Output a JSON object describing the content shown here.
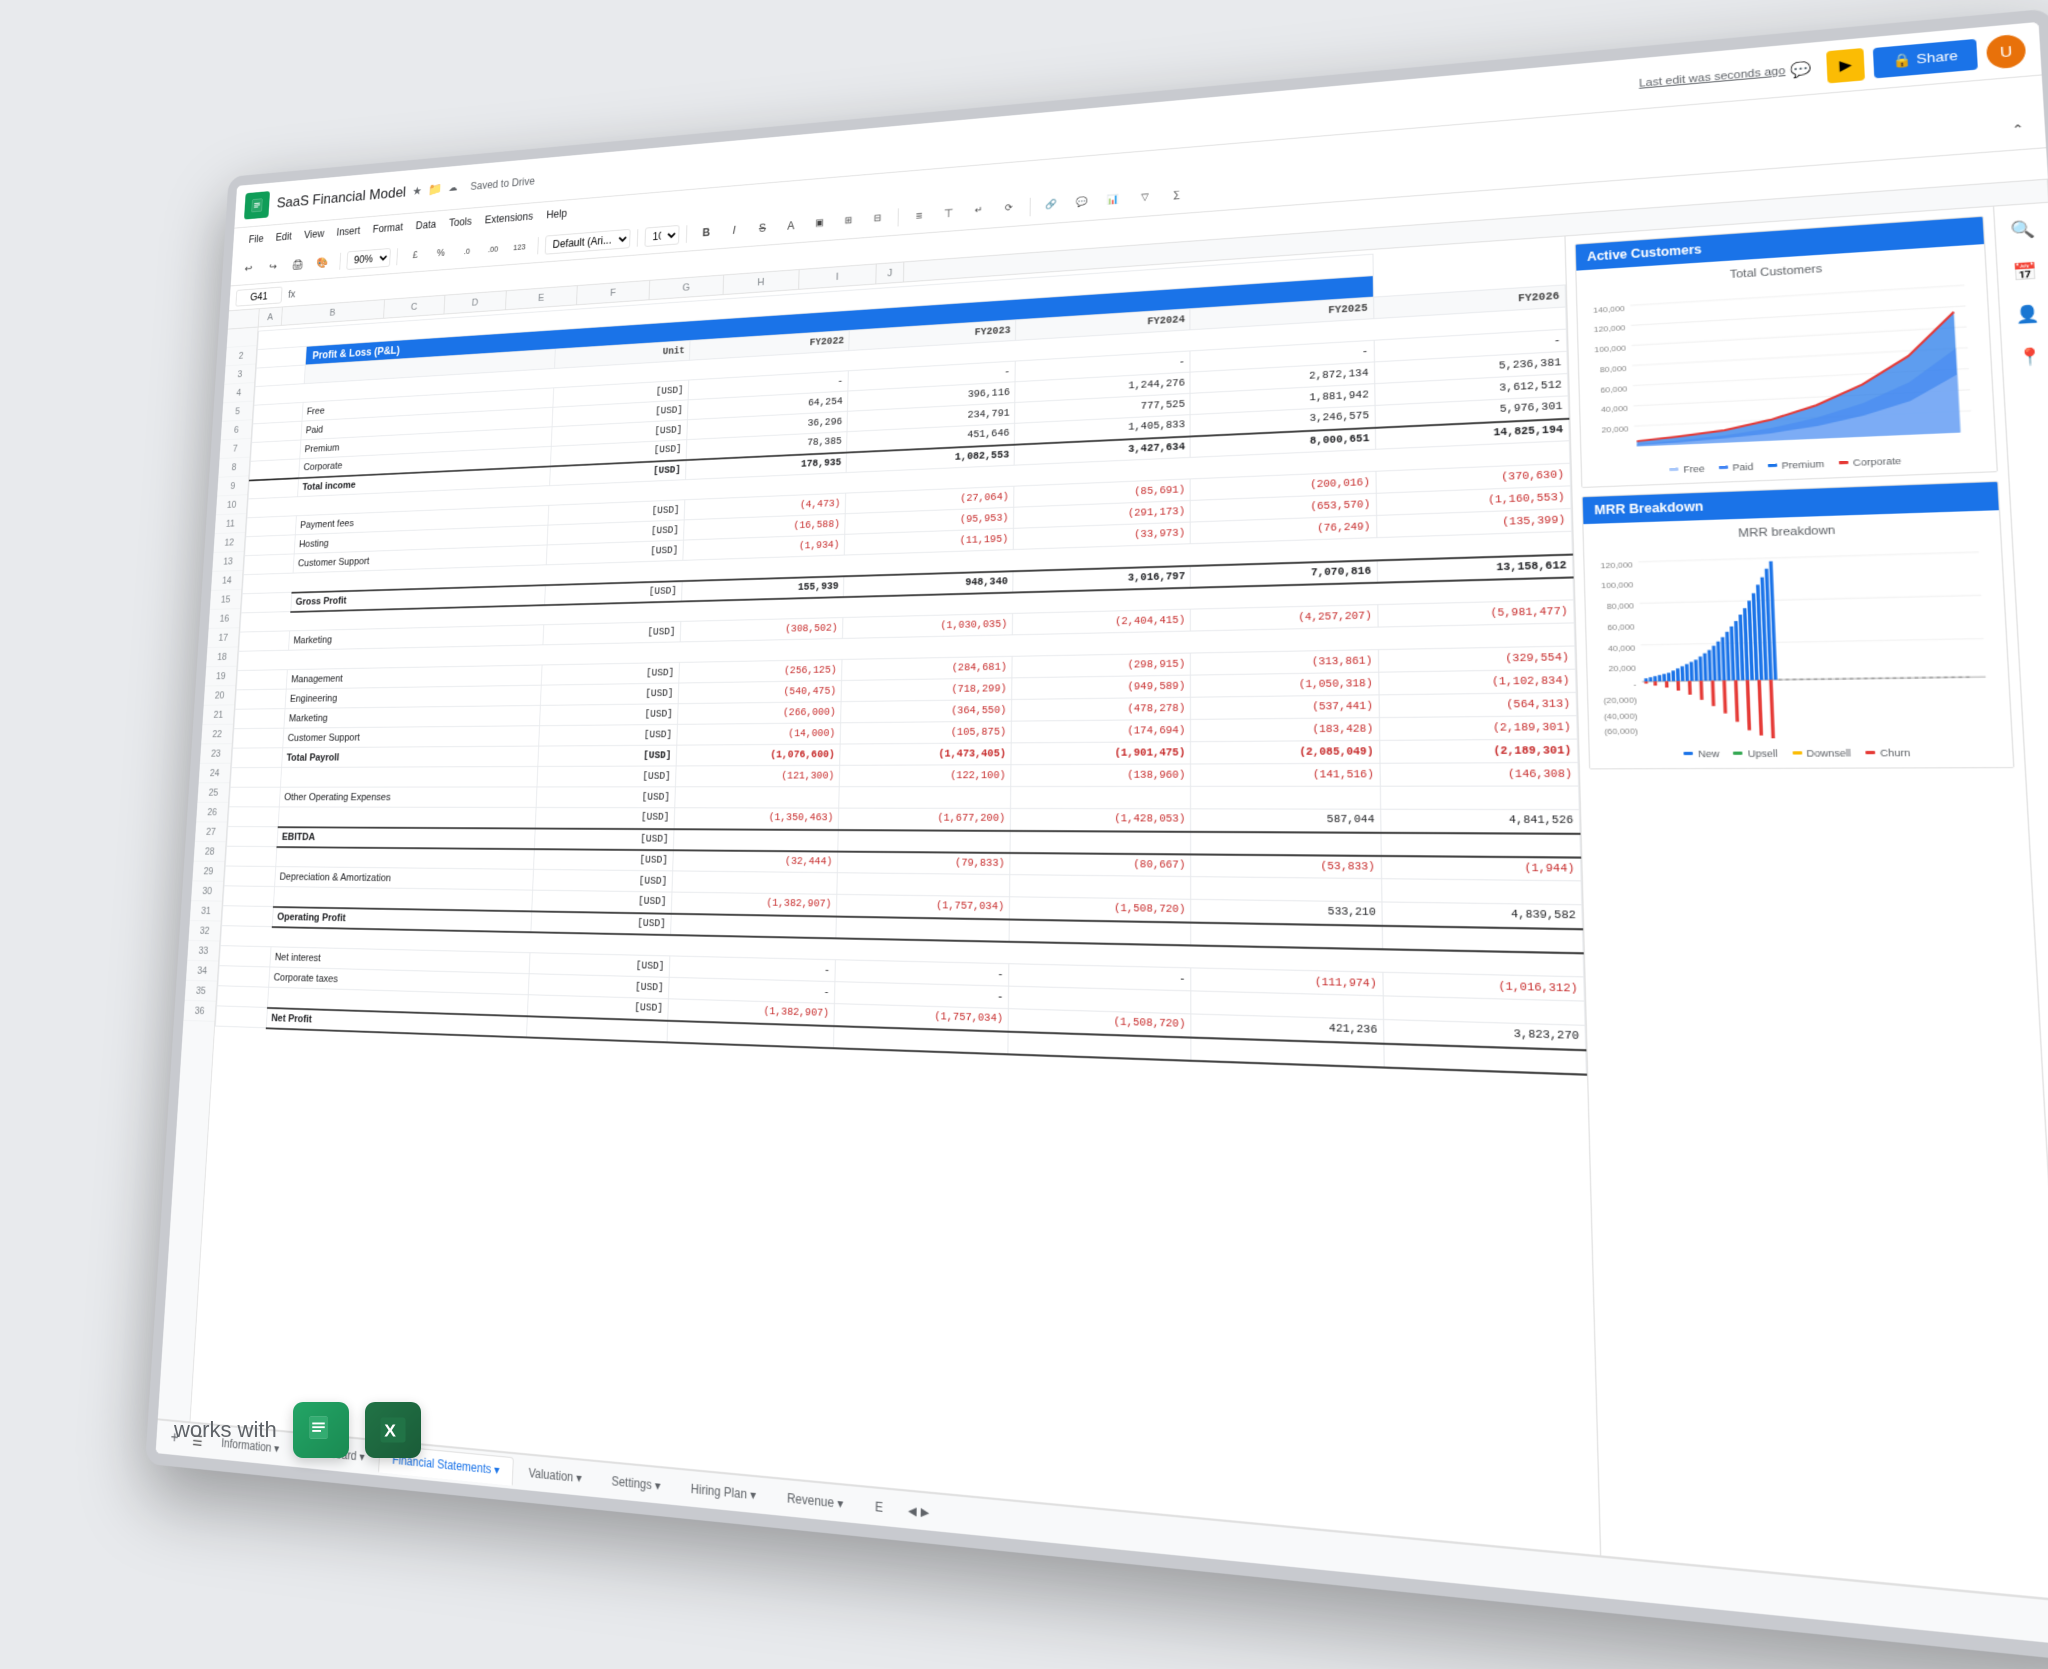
{
  "app": {
    "title": "SaaS Financial Model",
    "saved_status": "Saved to Drive",
    "last_edit": "Last edit was seconds ago",
    "share_label": "Share",
    "cell_ref": "G41",
    "zoom": "90%",
    "font": "Default (Ari...",
    "font_size": "10"
  },
  "menus": [
    "File",
    "Edit",
    "View",
    "Insert",
    "Format",
    "Data",
    "Tools",
    "Extensions",
    "Help"
  ],
  "tabs": [
    {
      "label": "Information",
      "active": false
    },
    {
      "label": "Dashboard",
      "active": false
    },
    {
      "label": "Financial Statements",
      "active": true
    },
    {
      "label": "Valuation",
      "active": false
    },
    {
      "label": "Settings",
      "active": false
    },
    {
      "label": "Hiring Plan",
      "active": false
    },
    {
      "label": "Revenue",
      "active": false
    },
    {
      "label": "E",
      "active": false
    }
  ],
  "pnl": {
    "title": "Profit & Loss (P&L)",
    "columns": [
      "",
      "Unit",
      "FY2022",
      "FY2023",
      "FY2024",
      "FY2025",
      "FY2026"
    ],
    "rows": [
      {
        "label": "Free",
        "unit": "[USD]",
        "fy2022": "-",
        "fy2023": "-",
        "fy2024": "-",
        "fy2025": "-",
        "fy2026": "-"
      },
      {
        "label": "Paid",
        "unit": "[USD]",
        "fy2022": "64,254",
        "fy2023": "396,116",
        "fy2024": "1,244,276",
        "fy2025": "2,872,134",
        "fy2026": "5,236,381"
      },
      {
        "label": "Premium",
        "unit": "[USD]",
        "fy2022": "36,296",
        "fy2023": "234,791",
        "fy2024": "777,525",
        "fy2025": "1,881,942",
        "fy2026": "3,612,512"
      },
      {
        "label": "Corporate",
        "unit": "[USD]",
        "fy2022": "78,385",
        "fy2023": "451,646",
        "fy2024": "1,405,833",
        "fy2025": "3,246,575",
        "fy2026": "5,976,301"
      },
      {
        "label": "Total income",
        "unit": "[USD]",
        "fy2022": "178,935",
        "fy2023": "1,082,553",
        "fy2024": "3,427,634",
        "fy2025": "8,000,651",
        "fy2026": "14,825,194",
        "bold": true
      },
      {
        "label": "",
        "empty": true
      },
      {
        "label": "Payment fees",
        "unit": "[USD]",
        "fy2022": "(4,473)",
        "fy2023": "(27,064)",
        "fy2024": "(85,691)",
        "fy2025": "(200,016)",
        "fy2026": "(370,630)",
        "neg": true
      },
      {
        "label": "Hosting",
        "unit": "[USD]",
        "fy2022": "(16,588)",
        "fy2023": "(95,953)",
        "fy2024": "(291,173)",
        "fy2025": "(653,570)",
        "fy2026": "(1,160,553)",
        "neg": true
      },
      {
        "label": "Customer Support",
        "unit": "[USD]",
        "fy2022": "(1,934)",
        "fy2023": "(11,195)",
        "fy2024": "(33,973)",
        "fy2025": "(76,249)",
        "fy2026": "(135,399)",
        "neg": true
      },
      {
        "label": "",
        "empty": true
      },
      {
        "label": "Gross Profit",
        "unit": "[USD]",
        "fy2022": "155,939",
        "fy2023": "948,340",
        "fy2024": "3,016,797",
        "fy2025": "7,070,816",
        "fy2026": "13,158,612",
        "bold": true,
        "total": true
      },
      {
        "label": "",
        "empty": true
      },
      {
        "label": "Marketing",
        "unit": "[USD]",
        "fy2022": "(308,502)",
        "fy2023": "(1,030,035)",
        "fy2024": "(2,404,415)",
        "fy2025": "(4,257,207)",
        "fy2026": "(5,981,477)",
        "neg": true
      },
      {
        "label": "",
        "empty": true
      },
      {
        "label": "Management",
        "unit": "[USD]",
        "fy2022": "(256,125)",
        "fy2023": "(284,681)",
        "fy2024": "(298,915)",
        "fy2025": "(313,861)",
        "fy2026": "(329,554)",
        "neg": true
      },
      {
        "label": "Engineering",
        "unit": "[USD]",
        "fy2022": "(540,475)",
        "fy2023": "(718,299)",
        "fy2024": "(949,589)",
        "fy2025": "(1,050,318)",
        "fy2026": "(1,102,834)",
        "neg": true
      },
      {
        "label": "Marketing",
        "unit": "[USD]",
        "fy2022": "(266,000)",
        "fy2023": "(364,550)",
        "fy2024": "(478,278)",
        "fy2025": "(537,441)",
        "fy2026": "(564,313)",
        "neg": true
      },
      {
        "label": "Customer Support",
        "unit": "[USD]",
        "fy2022": "(14,000)",
        "fy2023": "(105,875)",
        "fy2024": "(174,694)",
        "fy2025": "(183,428)",
        "fy2026": "(2,189,301)",
        "neg": true
      },
      {
        "label": "Total Payroll",
        "unit": "[USD]",
        "fy2022": "(1,076,600)",
        "fy2023": "(1,473,405)",
        "fy2024": "(1,901,475)",
        "fy2025": "(2,085,049)",
        "fy2026": "(2,189,301)",
        "bold": true,
        "neg": true
      },
      {
        "label": "",
        "empty": true
      },
      {
        "label": "",
        "unit": "[USD]",
        "fy2022": "(121,300)",
        "fy2023": "(122,100)",
        "fy2024": "(138,960)",
        "fy2025": "(141,516)",
        "fy2026": "(146,308)"
      },
      {
        "label": "Other Operating Expenses",
        "unit": "[USD]",
        "fy2022": "",
        "fy2023": "",
        "fy2024": "",
        "fy2025": "",
        "fy2026": ""
      },
      {
        "label": "",
        "unit": "[USD]",
        "fy2022": "(1,350,463)",
        "fy2023": "(1,677,200)",
        "fy2024": "(1,428,053)",
        "fy2025": "587,044",
        "fy2026": "4,841,526"
      },
      {
        "label": "EBITDA",
        "unit": "[USD]",
        "fy2022": "",
        "fy2023": "",
        "fy2024": "",
        "fy2025": "",
        "fy2026": "",
        "bold": true
      },
      {
        "label": "",
        "unit": "[USD]",
        "fy2022": "(32,444)",
        "fy2023": "(79,833)",
        "fy2024": "(80,667)",
        "fy2025": "(53,833)",
        "fy2026": "(1,944)"
      },
      {
        "label": "Depreciation & Amortization",
        "unit": "[USD]",
        "fy2022": "",
        "fy2023": "",
        "fy2024": "",
        "fy2025": "",
        "fy2026": ""
      },
      {
        "label": "",
        "unit": "[USD]",
        "fy2022": "(1,382,907)",
        "fy2023": "(1,757,034)",
        "fy2024": "(1,508,720)",
        "fy2025": "533,210",
        "fy2026": "4,839,582"
      },
      {
        "label": "Operating Profit",
        "unit": "[USD]",
        "fy2022": "",
        "fy2023": "",
        "fy2024": "",
        "fy2025": "",
        "fy2026": "",
        "bold": true,
        "total": true
      },
      {
        "label": "",
        "empty": true
      },
      {
        "label": "Net interest",
        "unit": "[USD]",
        "fy2022": "-",
        "fy2023": "-",
        "fy2024": "-",
        "fy2025": "(111,974)",
        "fy2026": "(1,016,312)"
      },
      {
        "label": "Corporate taxes",
        "unit": "[USD]",
        "fy2022": "-",
        "fy2023": "-",
        "fy2024": "",
        "fy2025": "",
        "fy2026": ""
      },
      {
        "label": "",
        "unit": "[USD]",
        "fy2022": "(1,382,907)",
        "fy2023": "(1,757,034)",
        "fy2024": "(1,508,720)",
        "fy2025": "421,236",
        "fy2026": "3,823,270"
      },
      {
        "label": "Net Profit",
        "unit": "[USD]",
        "fy2022": "",
        "fy2023": "",
        "fy2024": "",
        "fy2025": "",
        "fy2026": "",
        "bold": true,
        "total": true
      }
    ]
  },
  "charts": {
    "customers": {
      "title": "Active Customers",
      "subtitle": "Total Customers",
      "legend": [
        "Free",
        "Paid",
        "Premium",
        "Corporate"
      ]
    },
    "mrr": {
      "title": "MRR Breakdown",
      "subtitle": "MRR breakdown",
      "legend": [
        "New",
        "Upsell",
        "Downsell",
        "Churn"
      ]
    }
  },
  "works_with": {
    "text": "works with",
    "apps": [
      "Google Sheets",
      "Excel"
    ]
  }
}
